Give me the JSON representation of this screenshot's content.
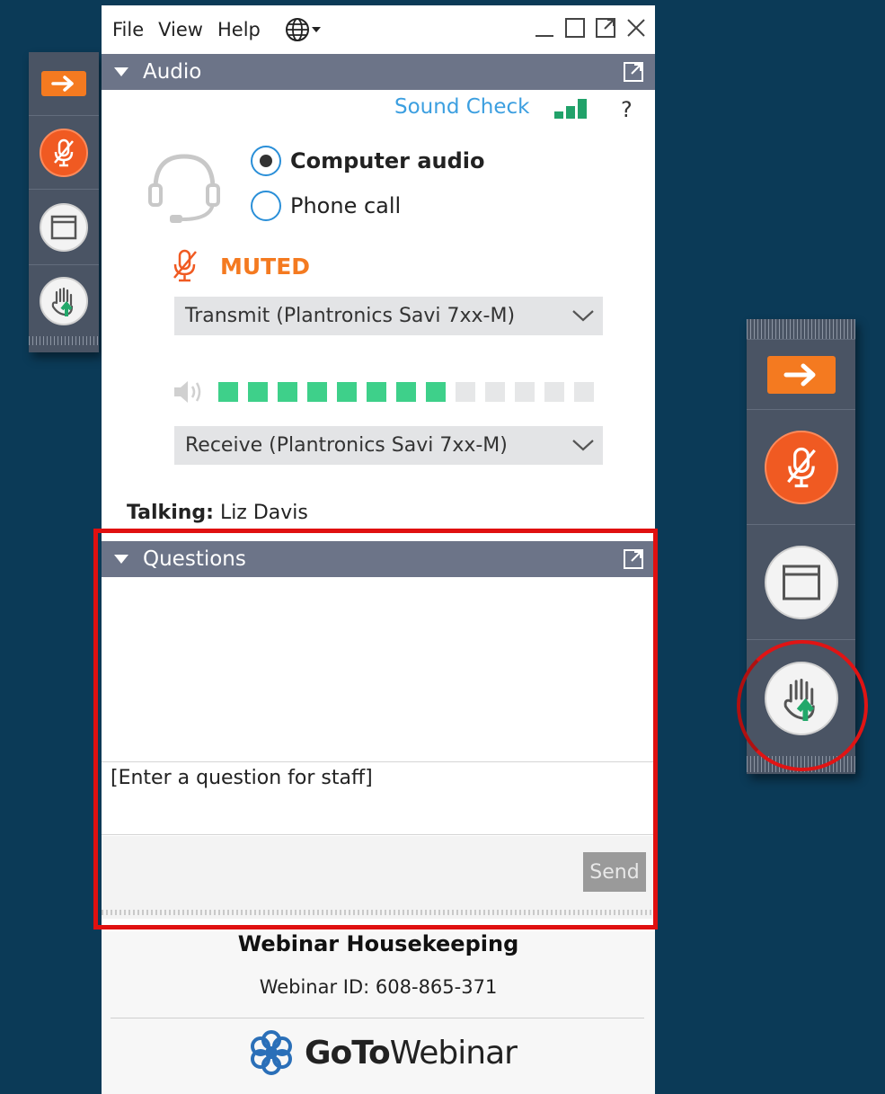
{
  "menu": {
    "file": "File",
    "view": "View",
    "help": "Help"
  },
  "audio": {
    "header": "Audio",
    "sound_check": "Sound Check",
    "help": "?",
    "options": [
      {
        "label": "Computer audio",
        "selected": true
      },
      {
        "label": "Phone call",
        "selected": false
      }
    ],
    "status": "MUTED",
    "transmit": "Transmit (Plantronics Savi 7xx-M)",
    "receive": "Receive (Plantronics Savi 7xx-M)",
    "level_active": 8,
    "level_total": 13,
    "talking_label": "Talking:",
    "talking_name": "Liz Davis"
  },
  "questions": {
    "header": "Questions",
    "placeholder": "[Enter a question for staff]",
    "send": "Send"
  },
  "footer": {
    "title": "Webinar Housekeeping",
    "webinar_id": "Webinar ID: 608-865-371",
    "logo_go": "GoTo",
    "logo_webinar": "Webinar"
  },
  "colors": {
    "background": "#0b3a57",
    "accent_orange": "#f47a20",
    "level_on": "#3ed08a",
    "level_off": "#e6e7e8",
    "link_blue": "#3c9fe0",
    "highlight_red": "#e01010"
  }
}
